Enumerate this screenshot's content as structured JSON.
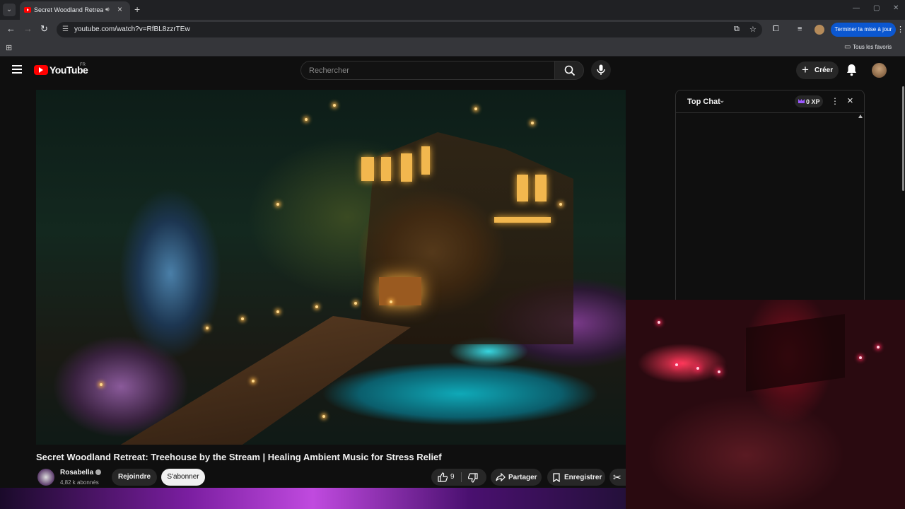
{
  "browser": {
    "tab_title": "Secret Woodland Retreat: T",
    "url": "youtube.com/watch?v=RfBL8zzrTEw",
    "update_button": "Terminer la mise à jour",
    "bookmarks_all": "Tous les favoris"
  },
  "masthead": {
    "logo_text": "YouTube",
    "region": "FR",
    "search_placeholder": "Rechercher",
    "create_label": "Créer"
  },
  "video": {
    "title": "Secret Woodland Retreat: Treehouse by the Stream | Healing Ambient Music for Stress Relief",
    "channel_name": "Rosabella",
    "subscribers": "4,82 k abonnés",
    "join_label": "Rejoindre",
    "subscribe_label": "S'abonner",
    "likes": "9",
    "share_label": "Partager",
    "save_label": "Enregistrer"
  },
  "chat": {
    "title": "Top Chat",
    "xp": "0 XP"
  },
  "colors": {
    "accent_blue": "#0b57d0",
    "youtube_red": "#ff0000",
    "background": "#0f0f0f"
  }
}
